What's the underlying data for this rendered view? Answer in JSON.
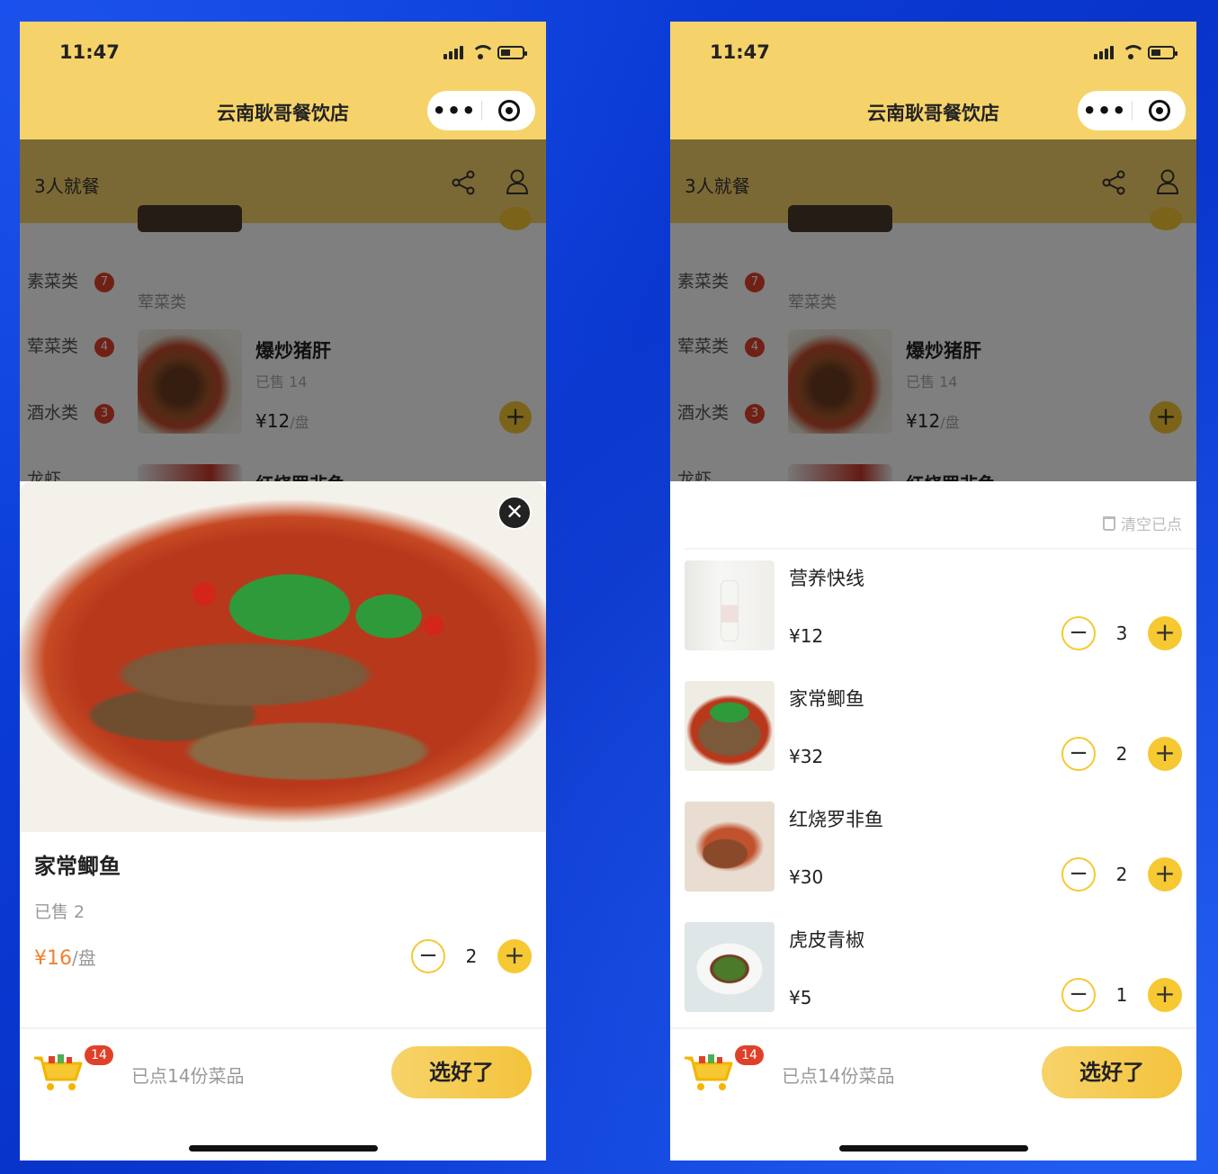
{
  "status": {
    "time": "11:47"
  },
  "app": {
    "title": "云南耿哥餐饮店",
    "capsule_more": "•••"
  },
  "subbar": {
    "label": "3人就餐"
  },
  "categories": [
    {
      "label": "素菜类",
      "count": "7"
    },
    {
      "label": "荤菜类",
      "count": "4"
    },
    {
      "label": "酒水类",
      "count": "3"
    },
    {
      "label": "龙虾",
      "count": ""
    }
  ],
  "menu": {
    "section_title": "荤菜类",
    "item": {
      "name": "爆炒猪肝",
      "sold": "已售 14",
      "price": "¥12",
      "unit": "/盘"
    },
    "next_item_name": "红烧罗非鱼"
  },
  "detail": {
    "name": "家常鲫鱼",
    "sold": "已售 2",
    "price": "¥16",
    "unit": "/盘",
    "quantity": "2",
    "close_symbol": "✕"
  },
  "cart_sheet": {
    "clear_label": "清空已点",
    "items": [
      {
        "name": "营养快线",
        "price": "¥12",
        "quantity": "3"
      },
      {
        "name": "家常鲫鱼",
        "price": "¥32",
        "quantity": "2"
      },
      {
        "name": "红烧罗非鱼",
        "price": "¥30",
        "quantity": "2"
      },
      {
        "name": "虎皮青椒",
        "price": "¥5",
        "quantity": "1"
      }
    ]
  },
  "cart_bar": {
    "badge": "14",
    "summary": "已点14份菜品",
    "submit_label": "选好了"
  },
  "controls": {
    "minus": "−",
    "plus": "+"
  },
  "colors": {
    "brand_yellow": "#f6d36a",
    "accent_yellow": "#f6c832",
    "badge_red": "#e0402a",
    "price_orange": "#f0822e",
    "background_blue": "#0a3fd8"
  },
  "icons": [
    "signal-icon",
    "wifi-icon",
    "battery-icon",
    "more-icon",
    "target-icon",
    "share-icon",
    "user-icon",
    "close-icon",
    "trash-icon",
    "cart-icon"
  ]
}
